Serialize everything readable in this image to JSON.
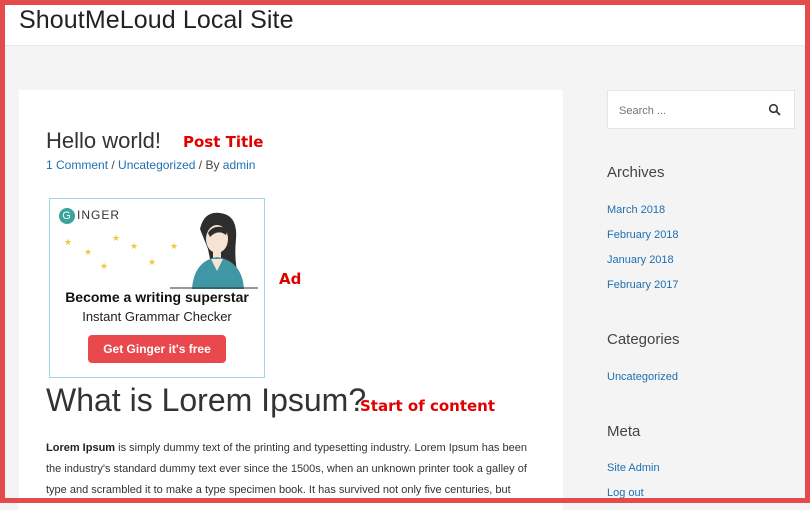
{
  "site": {
    "title": "ShoutMeLoud Local Site"
  },
  "post": {
    "title": "Hello world!",
    "meta": {
      "comments": "1 Comment",
      "sep1": " / ",
      "category": "Uncategorized",
      "sep2": " / By ",
      "author": "admin"
    }
  },
  "annotations": {
    "post_title": "Post Title",
    "ad": "Ad",
    "content_start": "Start of content"
  },
  "ad": {
    "brand": "INGER",
    "brand_initial": "G",
    "headline": "Become a writing superstar",
    "subline": "Instant Grammar Checker",
    "button": "Get Ginger it's free",
    "colors": {
      "button": "#e9484d",
      "border": "#9ed6e6",
      "logo": "#3aa39c"
    }
  },
  "content": {
    "heading": "What is Lorem Ipsum?",
    "lead_bold": "Lorem Ipsum",
    "paragraph": " is simply dummy text of the printing and typesetting industry. Lorem Ipsum has been the industry's standard dummy text ever since the 1500s, when an unknown printer took a galley of type and scrambled it to make a type specimen book. It has survived not only five centuries, but"
  },
  "sidebar": {
    "search_placeholder": "Search ...",
    "archives": {
      "title": "Archives",
      "items": [
        "March 2018",
        "February 2018",
        "January 2018",
        "February 2017"
      ]
    },
    "categories": {
      "title": "Categories",
      "items": [
        "Uncategorized"
      ]
    },
    "meta": {
      "title": "Meta",
      "items": [
        "Site Admin",
        "Log out"
      ]
    }
  },
  "colors": {
    "frame": "#e44b4b",
    "link": "#1f6fb0",
    "annotation": "#e10000"
  }
}
